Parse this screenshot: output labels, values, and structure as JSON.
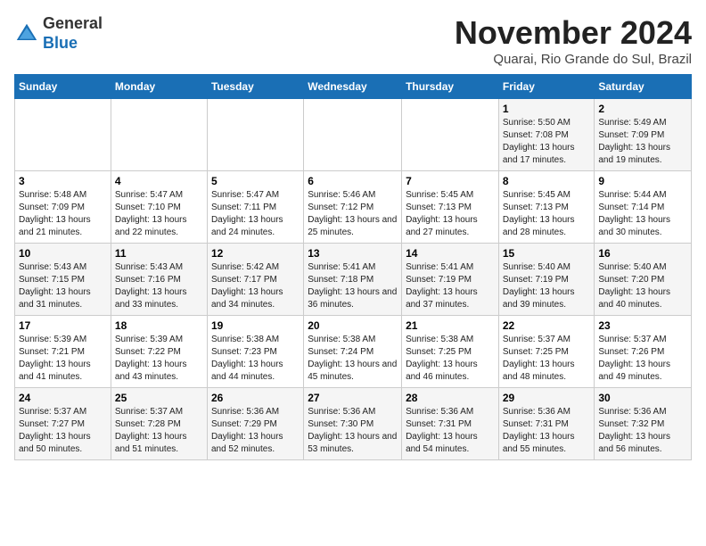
{
  "header": {
    "logo_line1": "General",
    "logo_line2": "Blue",
    "title": "November 2024",
    "subtitle": "Quarai, Rio Grande do Sul, Brazil"
  },
  "weekdays": [
    "Sunday",
    "Monday",
    "Tuesday",
    "Wednesday",
    "Thursday",
    "Friday",
    "Saturday"
  ],
  "weeks": [
    [
      {
        "day": "",
        "sunrise": "",
        "sunset": "",
        "daylight": ""
      },
      {
        "day": "",
        "sunrise": "",
        "sunset": "",
        "daylight": ""
      },
      {
        "day": "",
        "sunrise": "",
        "sunset": "",
        "daylight": ""
      },
      {
        "day": "",
        "sunrise": "",
        "sunset": "",
        "daylight": ""
      },
      {
        "day": "",
        "sunrise": "",
        "sunset": "",
        "daylight": ""
      },
      {
        "day": "1",
        "sunrise": "Sunrise: 5:50 AM",
        "sunset": "Sunset: 7:08 PM",
        "daylight": "Daylight: 13 hours and 17 minutes."
      },
      {
        "day": "2",
        "sunrise": "Sunrise: 5:49 AM",
        "sunset": "Sunset: 7:09 PM",
        "daylight": "Daylight: 13 hours and 19 minutes."
      }
    ],
    [
      {
        "day": "3",
        "sunrise": "Sunrise: 5:48 AM",
        "sunset": "Sunset: 7:09 PM",
        "daylight": "Daylight: 13 hours and 21 minutes."
      },
      {
        "day": "4",
        "sunrise": "Sunrise: 5:47 AM",
        "sunset": "Sunset: 7:10 PM",
        "daylight": "Daylight: 13 hours and 22 minutes."
      },
      {
        "day": "5",
        "sunrise": "Sunrise: 5:47 AM",
        "sunset": "Sunset: 7:11 PM",
        "daylight": "Daylight: 13 hours and 24 minutes."
      },
      {
        "day": "6",
        "sunrise": "Sunrise: 5:46 AM",
        "sunset": "Sunset: 7:12 PM",
        "daylight": "Daylight: 13 hours and 25 minutes."
      },
      {
        "day": "7",
        "sunrise": "Sunrise: 5:45 AM",
        "sunset": "Sunset: 7:13 PM",
        "daylight": "Daylight: 13 hours and 27 minutes."
      },
      {
        "day": "8",
        "sunrise": "Sunrise: 5:45 AM",
        "sunset": "Sunset: 7:13 PM",
        "daylight": "Daylight: 13 hours and 28 minutes."
      },
      {
        "day": "9",
        "sunrise": "Sunrise: 5:44 AM",
        "sunset": "Sunset: 7:14 PM",
        "daylight": "Daylight: 13 hours and 30 minutes."
      }
    ],
    [
      {
        "day": "10",
        "sunrise": "Sunrise: 5:43 AM",
        "sunset": "Sunset: 7:15 PM",
        "daylight": "Daylight: 13 hours and 31 minutes."
      },
      {
        "day": "11",
        "sunrise": "Sunrise: 5:43 AM",
        "sunset": "Sunset: 7:16 PM",
        "daylight": "Daylight: 13 hours and 33 minutes."
      },
      {
        "day": "12",
        "sunrise": "Sunrise: 5:42 AM",
        "sunset": "Sunset: 7:17 PM",
        "daylight": "Daylight: 13 hours and 34 minutes."
      },
      {
        "day": "13",
        "sunrise": "Sunrise: 5:41 AM",
        "sunset": "Sunset: 7:18 PM",
        "daylight": "Daylight: 13 hours and 36 minutes."
      },
      {
        "day": "14",
        "sunrise": "Sunrise: 5:41 AM",
        "sunset": "Sunset: 7:19 PM",
        "daylight": "Daylight: 13 hours and 37 minutes."
      },
      {
        "day": "15",
        "sunrise": "Sunrise: 5:40 AM",
        "sunset": "Sunset: 7:19 PM",
        "daylight": "Daylight: 13 hours and 39 minutes."
      },
      {
        "day": "16",
        "sunrise": "Sunrise: 5:40 AM",
        "sunset": "Sunset: 7:20 PM",
        "daylight": "Daylight: 13 hours and 40 minutes."
      }
    ],
    [
      {
        "day": "17",
        "sunrise": "Sunrise: 5:39 AM",
        "sunset": "Sunset: 7:21 PM",
        "daylight": "Daylight: 13 hours and 41 minutes."
      },
      {
        "day": "18",
        "sunrise": "Sunrise: 5:39 AM",
        "sunset": "Sunset: 7:22 PM",
        "daylight": "Daylight: 13 hours and 43 minutes."
      },
      {
        "day": "19",
        "sunrise": "Sunrise: 5:38 AM",
        "sunset": "Sunset: 7:23 PM",
        "daylight": "Daylight: 13 hours and 44 minutes."
      },
      {
        "day": "20",
        "sunrise": "Sunrise: 5:38 AM",
        "sunset": "Sunset: 7:24 PM",
        "daylight": "Daylight: 13 hours and 45 minutes."
      },
      {
        "day": "21",
        "sunrise": "Sunrise: 5:38 AM",
        "sunset": "Sunset: 7:25 PM",
        "daylight": "Daylight: 13 hours and 46 minutes."
      },
      {
        "day": "22",
        "sunrise": "Sunrise: 5:37 AM",
        "sunset": "Sunset: 7:25 PM",
        "daylight": "Daylight: 13 hours and 48 minutes."
      },
      {
        "day": "23",
        "sunrise": "Sunrise: 5:37 AM",
        "sunset": "Sunset: 7:26 PM",
        "daylight": "Daylight: 13 hours and 49 minutes."
      }
    ],
    [
      {
        "day": "24",
        "sunrise": "Sunrise: 5:37 AM",
        "sunset": "Sunset: 7:27 PM",
        "daylight": "Daylight: 13 hours and 50 minutes."
      },
      {
        "day": "25",
        "sunrise": "Sunrise: 5:37 AM",
        "sunset": "Sunset: 7:28 PM",
        "daylight": "Daylight: 13 hours and 51 minutes."
      },
      {
        "day": "26",
        "sunrise": "Sunrise: 5:36 AM",
        "sunset": "Sunset: 7:29 PM",
        "daylight": "Daylight: 13 hours and 52 minutes."
      },
      {
        "day": "27",
        "sunrise": "Sunrise: 5:36 AM",
        "sunset": "Sunset: 7:30 PM",
        "daylight": "Daylight: 13 hours and 53 minutes."
      },
      {
        "day": "28",
        "sunrise": "Sunrise: 5:36 AM",
        "sunset": "Sunset: 7:31 PM",
        "daylight": "Daylight: 13 hours and 54 minutes."
      },
      {
        "day": "29",
        "sunrise": "Sunrise: 5:36 AM",
        "sunset": "Sunset: 7:31 PM",
        "daylight": "Daylight: 13 hours and 55 minutes."
      },
      {
        "day": "30",
        "sunrise": "Sunrise: 5:36 AM",
        "sunset": "Sunset: 7:32 PM",
        "daylight": "Daylight: 13 hours and 56 minutes."
      }
    ]
  ]
}
